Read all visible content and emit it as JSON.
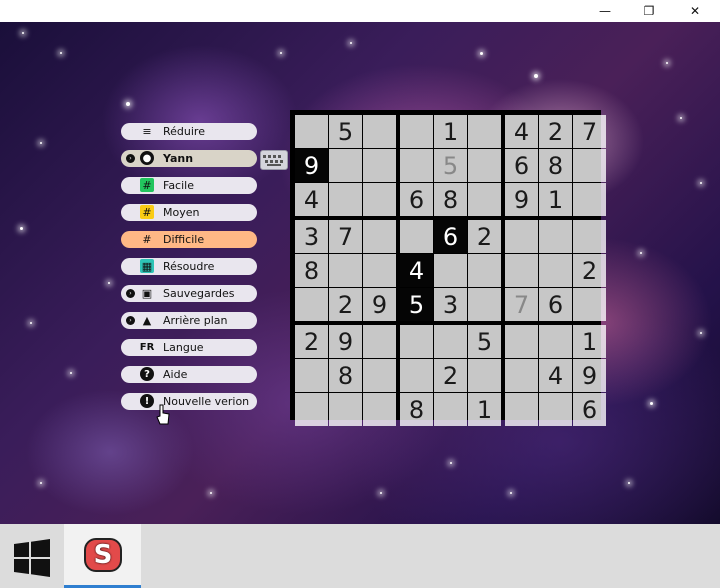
{
  "window": {
    "minimize": "—",
    "restore": "❐",
    "close": "✕"
  },
  "menu": [
    {
      "id": "reduire",
      "label": "Réduire",
      "icon": "≡",
      "dot": false,
      "bold": false,
      "bg": "#e9e6ee"
    },
    {
      "id": "user",
      "label": "Yann",
      "icon": "●",
      "dot": true,
      "bold": true,
      "bg": "#d9d4c8"
    },
    {
      "id": "facile",
      "label": "Facile",
      "icon": "#",
      "dot": false,
      "bold": false,
      "bg": "#e9e6ee",
      "icon_bg": "#22c55e"
    },
    {
      "id": "moyen",
      "label": "Moyen",
      "icon": "#",
      "dot": false,
      "bold": false,
      "bg": "#e9e6ee",
      "icon_bg": "#facc15"
    },
    {
      "id": "difficile",
      "label": "Difficile",
      "icon": "#",
      "dot": false,
      "bold": false,
      "bg": "#ffb885"
    },
    {
      "id": "resoudre",
      "label": "Résoudre",
      "icon": "▦",
      "dot": false,
      "bold": false,
      "bg": "#e9e6ee",
      "icon_bg": "#2ec4b6"
    },
    {
      "id": "sauvegardes",
      "label": "Sauvegardes",
      "icon": "▣",
      "dot": true,
      "bold": false,
      "bg": "#e9e6ee"
    },
    {
      "id": "arriere",
      "label": "Arrière plan",
      "icon": "▲",
      "dot": true,
      "bold": false,
      "bg": "#e9e6ee"
    },
    {
      "id": "langue",
      "label": "Langue",
      "icon": "FR",
      "dot": false,
      "bold": false,
      "bg": "#e9e6ee"
    },
    {
      "id": "aide",
      "label": "Aide",
      "icon": "?",
      "dot": false,
      "bold": false,
      "bg": "#e9e6ee"
    },
    {
      "id": "nouvelle",
      "label": "Nouvelle verion",
      "icon": "!",
      "dot": false,
      "bold": false,
      "bg": "#e9e6ee"
    }
  ],
  "grid": [
    [
      "",
      "5",
      "",
      "",
      "1",
      "",
      "4",
      "2",
      "7"
    ],
    [
      "9",
      "",
      "",
      "",
      "5",
      "",
      "6",
      "8",
      ""
    ],
    [
      "4",
      "",
      "",
      "6",
      "8",
      "",
      "9",
      "1",
      ""
    ],
    [
      "3",
      "7",
      "",
      "",
      "6",
      "2",
      "",
      "",
      ""
    ],
    [
      "8",
      "",
      "",
      "4",
      "",
      "",
      "",
      "",
      "2"
    ],
    [
      "",
      "2",
      "9",
      "5",
      "3",
      "",
      "7",
      "6",
      ""
    ],
    [
      "2",
      "9",
      "",
      "",
      "",
      "5",
      "",
      "",
      "1"
    ],
    [
      "",
      "8",
      "",
      "",
      "2",
      "",
      "",
      "4",
      "9"
    ],
    [
      "",
      "",
      "",
      "8",
      "",
      "1",
      "",
      "",
      "6"
    ]
  ],
  "dark_cells": [
    [
      1,
      0
    ],
    [
      3,
      4
    ],
    [
      4,
      3
    ],
    [
      5,
      3
    ]
  ],
  "hint_cells": [
    [
      1,
      4
    ],
    [
      5,
      6
    ]
  ],
  "taskbar": {
    "app_icon": "S",
    "start_icon": "windows-logo"
  }
}
